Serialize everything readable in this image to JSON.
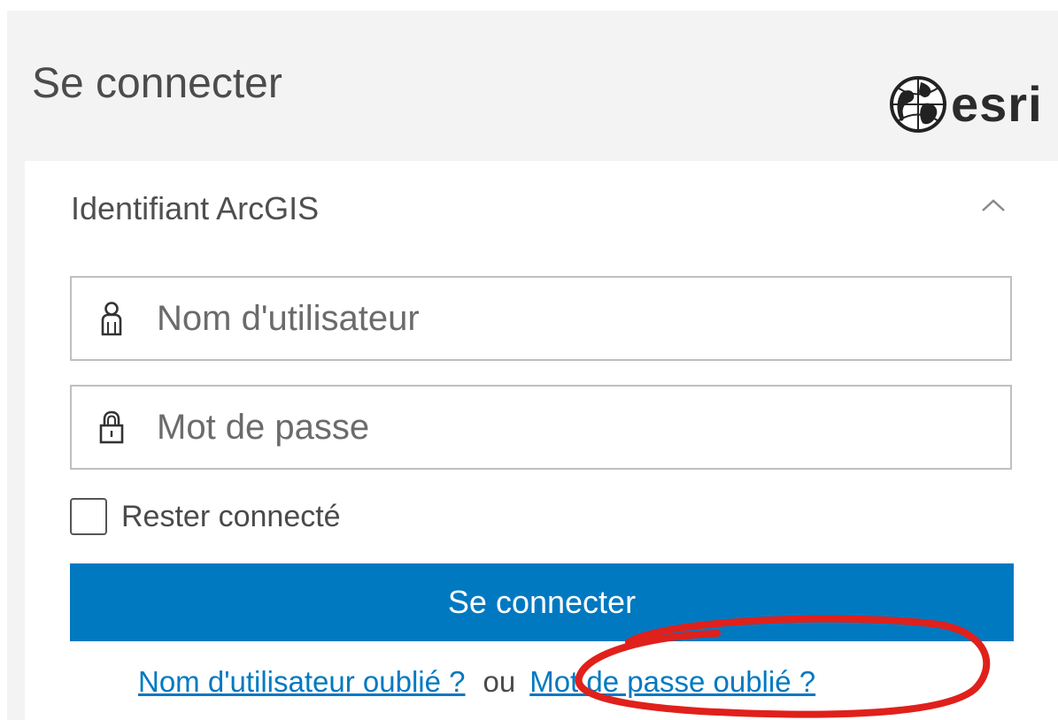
{
  "header": {
    "title": "Se connecter",
    "logo_text": "esri"
  },
  "login": {
    "section_title": "Identifiant ArcGIS",
    "username_placeholder": "Nom d'utilisateur",
    "password_placeholder": "Mot de passe",
    "remember_label": "Rester connecté",
    "submit_label": "Se connecter",
    "forgot_username": "Nom d'utilisateur oublié ?",
    "separator": "ou",
    "forgot_password": "Mot de passe oublié ?"
  },
  "colors": {
    "accent": "#0079c1",
    "header_background": "#f3f3f3",
    "annotation": "#e0201b"
  },
  "icons": {
    "logo": "globe-icon",
    "collapse": "chevron-up-icon",
    "username": "user-icon",
    "password": "lock-icon"
  }
}
